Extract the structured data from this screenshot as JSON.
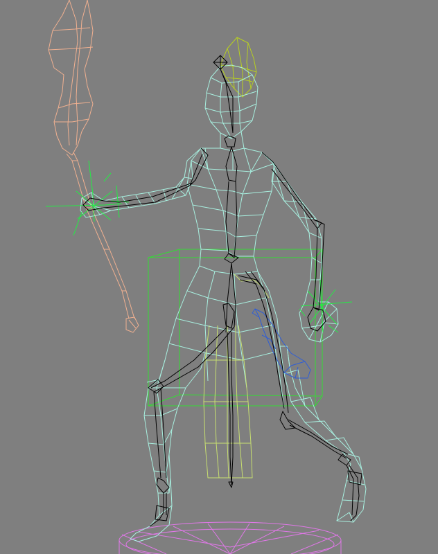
{
  "viewport": {
    "background_color": "#7f7f7f"
  },
  "colors": {
    "body_mesh": "#a8f0e0",
    "bone_chain": "#000000",
    "spear": "#f0b090",
    "hair": "#b8d020",
    "bounding_box": "#33dd33",
    "hand_helpers": "#22ee44",
    "skirt_cloth": "#c8e070",
    "dagger": "#2d5dd8",
    "pedestal": "#e078e8"
  },
  "objects": [
    {
      "name": "character-mesh",
      "color_key": "body_mesh"
    },
    {
      "name": "bone-skeleton",
      "color_key": "bone_chain"
    },
    {
      "name": "spear",
      "color_key": "spear"
    },
    {
      "name": "hair-mesh",
      "color_key": "hair"
    },
    {
      "name": "bounding-box",
      "color_key": "bounding_box"
    },
    {
      "name": "dagger",
      "color_key": "dagger"
    },
    {
      "name": "pedestal",
      "color_key": "pedestal"
    }
  ]
}
